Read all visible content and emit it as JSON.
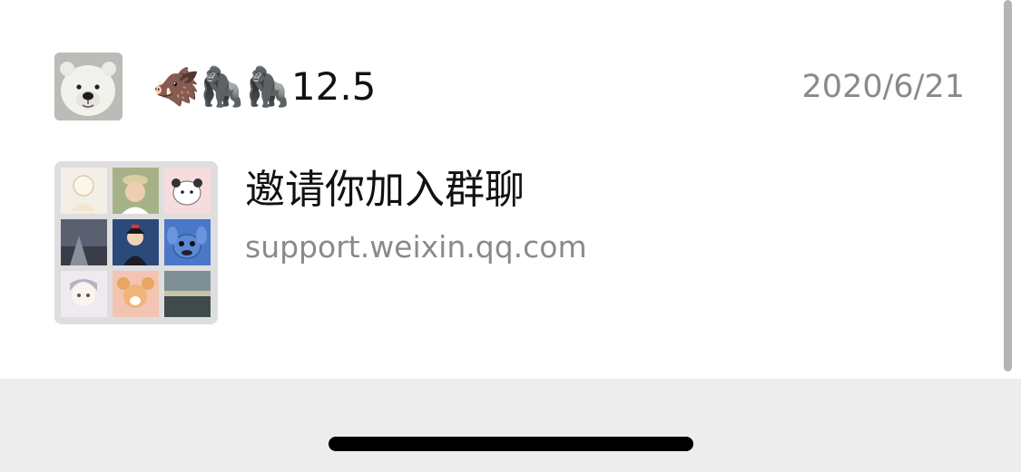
{
  "message": {
    "sender": {
      "emoji": "🐗🦍🦍",
      "name": "12.5",
      "avatar_icon": "polar-bear-avatar"
    },
    "date": "2020/6/21",
    "link_card": {
      "title": "邀请你加入群聊",
      "url": "support.weixin.qq.com",
      "thumbnail_icon": "group-avatar-grid"
    }
  },
  "colors": {
    "background": "#ffffff",
    "primary_text": "#111111",
    "secondary_text": "#8a8a8a",
    "bottom_area": "#ededed",
    "home_indicator": "#000000",
    "scrollbar": "#b4b4b4"
  }
}
